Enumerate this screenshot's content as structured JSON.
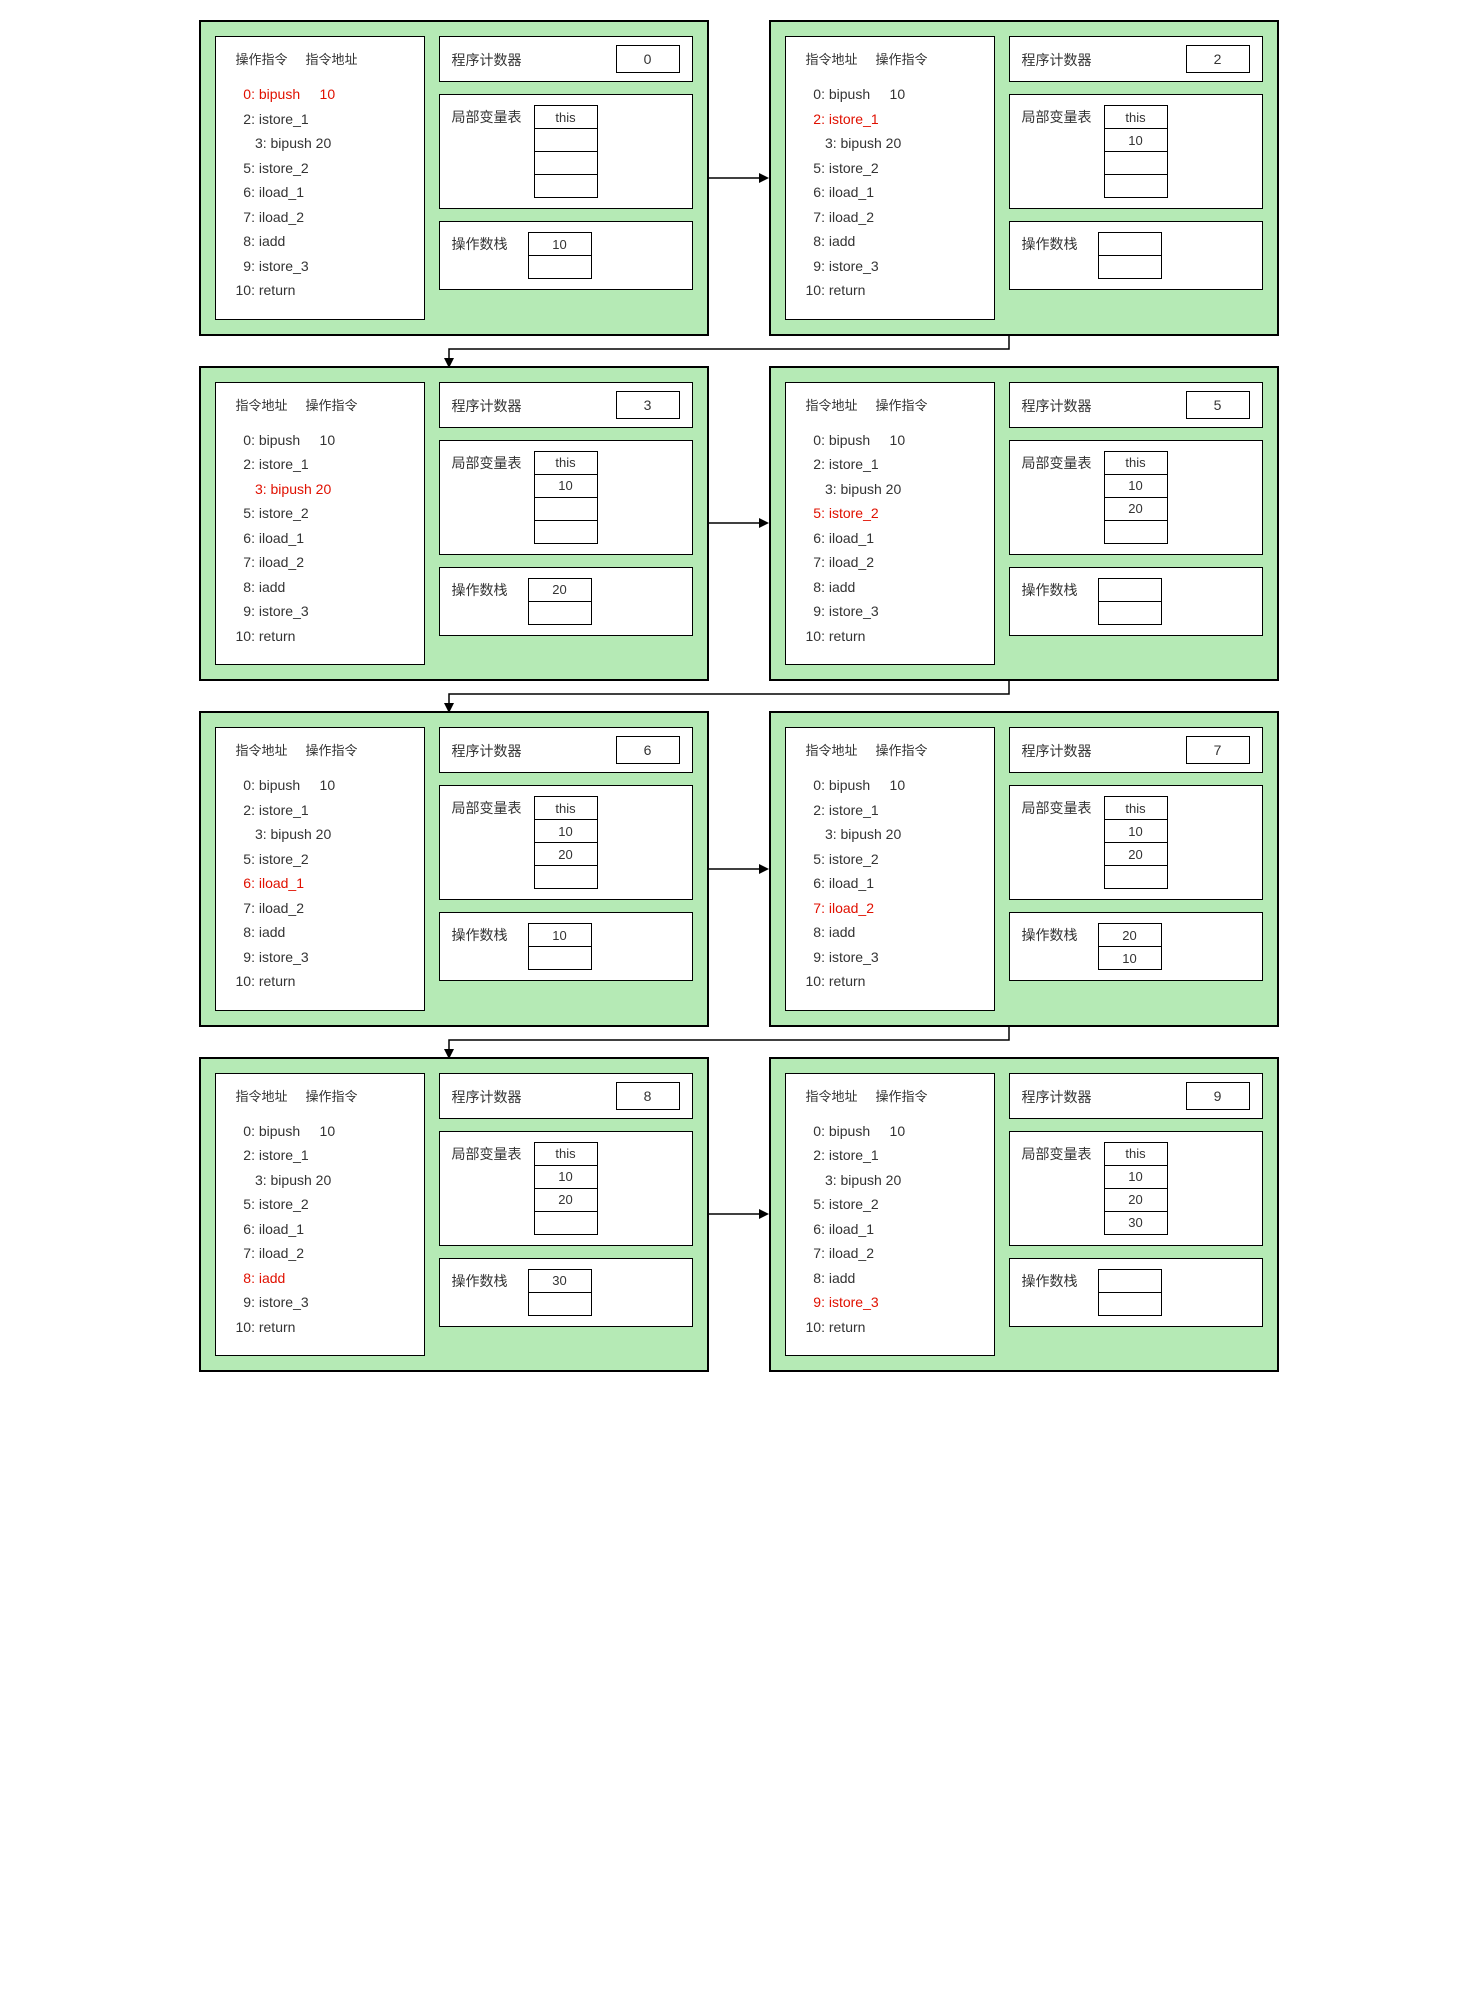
{
  "labels": {
    "operationInstruction": "操作指令",
    "instructionAddress": "指令地址",
    "programCounter": "程序计数器",
    "localVarTable": "局部变量表",
    "operandStack": "操作数栈"
  },
  "instructions": [
    {
      "addr": "0",
      "op": "bipush",
      "arg": "10",
      "indent": 1
    },
    {
      "addr": "2",
      "op": "istore_1",
      "arg": "",
      "indent": 1
    },
    {
      "addr": "3",
      "op": "bipush 20",
      "arg": "",
      "indent": 2
    },
    {
      "addr": "5",
      "op": "istore_2",
      "arg": "",
      "indent": 1
    },
    {
      "addr": "6",
      "op": "iload_1",
      "arg": "",
      "indent": 1
    },
    {
      "addr": "7",
      "op": "iload_2",
      "arg": "",
      "indent": 1
    },
    {
      "addr": "8",
      "op": "iadd",
      "arg": "",
      "indent": 1
    },
    {
      "addr": "9",
      "op": "istore_3",
      "arg": "",
      "indent": 1
    },
    {
      "addr": "10",
      "op": "return",
      "arg": "",
      "indent": 0
    }
  ],
  "frames": [
    {
      "headerOrder": [
        "op",
        "addr"
      ],
      "highlight": 0,
      "pc": "0",
      "locals": [
        "this",
        "",
        "",
        ""
      ],
      "stack": [
        "10",
        ""
      ]
    },
    {
      "headerOrder": [
        "addr",
        "op"
      ],
      "highlight": 1,
      "pc": "2",
      "locals": [
        "this",
        "10",
        "",
        ""
      ],
      "stack": [
        "",
        ""
      ]
    },
    {
      "headerOrder": [
        "addr",
        "op"
      ],
      "highlight": 2,
      "pc": "3",
      "locals": [
        "this",
        "10",
        "",
        ""
      ],
      "stack": [
        "20",
        ""
      ]
    },
    {
      "headerOrder": [
        "addr",
        "op"
      ],
      "highlight": 3,
      "pc": "5",
      "locals": [
        "this",
        "10",
        "20",
        ""
      ],
      "stack": [
        "",
        ""
      ]
    },
    {
      "headerOrder": [
        "addr",
        "op"
      ],
      "highlight": 4,
      "pc": "6",
      "locals": [
        "this",
        "10",
        "20",
        ""
      ],
      "stack": [
        "10",
        ""
      ]
    },
    {
      "headerOrder": [
        "addr",
        "op"
      ],
      "highlight": 5,
      "pc": "7",
      "locals": [
        "this",
        "10",
        "20",
        ""
      ],
      "stack": [
        "20",
        "10"
      ]
    },
    {
      "headerOrder": [
        "addr",
        "op"
      ],
      "highlight": 6,
      "pc": "8",
      "locals": [
        "this",
        "10",
        "20",
        ""
      ],
      "stack": [
        "30",
        ""
      ]
    },
    {
      "headerOrder": [
        "addr",
        "op"
      ],
      "highlight": 7,
      "pc": "9",
      "locals": [
        "this",
        "10",
        "20",
        "30"
      ],
      "stack": [
        "",
        ""
      ]
    }
  ]
}
